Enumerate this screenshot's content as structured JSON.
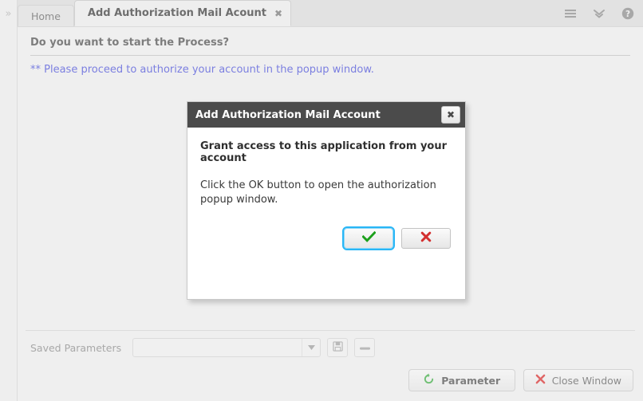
{
  "window": {
    "rail_expand_icon": "chevrons-right-icon"
  },
  "tabbar": {
    "tabs": [
      {
        "label": "Home",
        "active": false,
        "closable": false
      },
      {
        "label": "Add Authorization Mail Acount",
        "active": true,
        "closable": true
      }
    ],
    "close_glyph": "✖",
    "icons": [
      {
        "name": "hamburger-menu-icon",
        "title": "Menu"
      },
      {
        "name": "chevrons-down-icon",
        "title": "More"
      },
      {
        "name": "help-icon",
        "title": "Help"
      }
    ]
  },
  "content": {
    "prompt": "Do you want to start the Process?",
    "note": "** Please proceed to authorize your account in the popup window."
  },
  "parameters": {
    "label": "Saved Parameters",
    "combo_value": "",
    "combo_placeholder": "",
    "save_icon": "floppy-disk-icon",
    "remove_icon": "minus-icon",
    "dropdown_icon": "caret-down-icon"
  },
  "footer": {
    "parameter_button": {
      "label": "Parameter",
      "icon": "reset-circular-arrow-icon",
      "icon_color": "#6fbf73"
    },
    "close_button": {
      "label": "Close Window",
      "icon": "close-x-icon",
      "icon_color": "#e06666"
    }
  },
  "dialog": {
    "title": "Add Authorization Mail Account",
    "close_glyph": "✖",
    "heading": "Grant access to this application from your account",
    "body": "Click the OK button to open the authorization popup window.",
    "ok_button": {
      "name": "ok",
      "icon": "check-icon",
      "icon_color": "#1ca01c",
      "focused": true
    },
    "cancel_button": {
      "name": "cancel",
      "icon": "cross-icon",
      "icon_color": "#d32f2f",
      "focused": false
    }
  },
  "colors": {
    "window_bg": "#efefef",
    "tabbar_bg": "#e2e2e2",
    "note_text": "#7b7fe0",
    "dialog_titlebar": "#4b4b4b",
    "focus_ring": "#29b6f6"
  }
}
